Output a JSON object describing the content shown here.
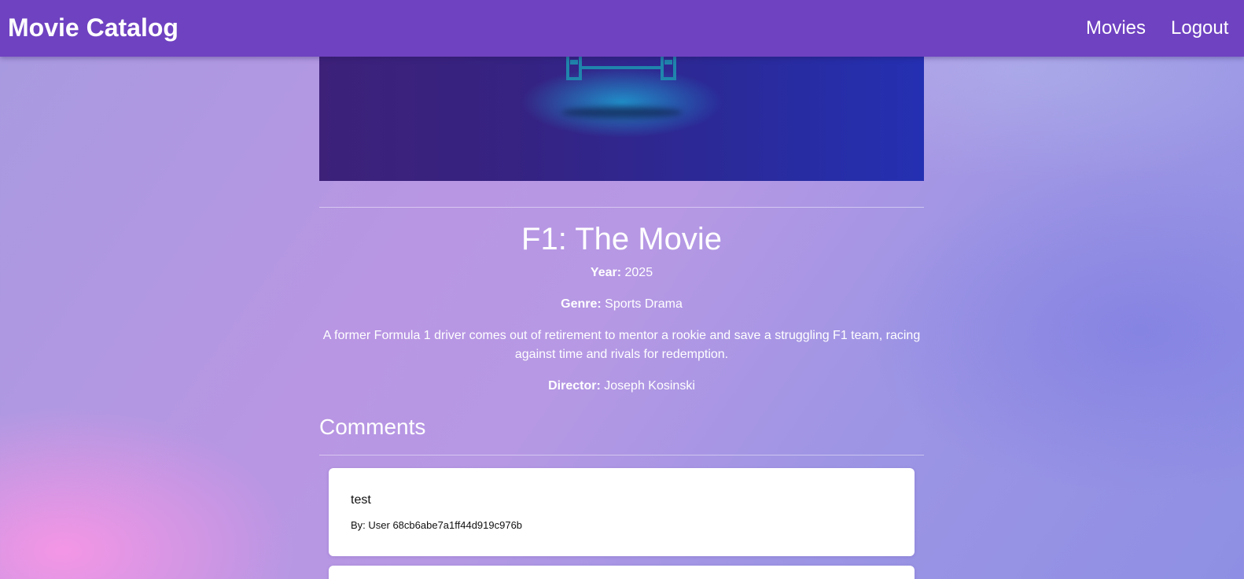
{
  "navbar": {
    "brand": "Movie Catalog",
    "links": [
      "Movies",
      "Logout"
    ],
    "background": "#6f42c1"
  },
  "poster": {
    "icon": "film-reel-icon",
    "colors": [
      "#3d2179",
      "#2430b2",
      "#1e9fd2"
    ]
  },
  "movie": {
    "title": "F1: The Movie",
    "year_label": "Year:",
    "year": "2025",
    "genre_label": "Genre:",
    "genre": "Sports Drama",
    "description": "A former Formula 1 driver comes out of retirement to mentor a rookie and save a struggling F1 team, racing against time and rivals for redemption.",
    "director_label": "Director:",
    "director": "Joseph Kosinski"
  },
  "comments": {
    "heading": "Comments",
    "items": [
      {
        "text": "test",
        "author": "By: User 68cb6abe7a1ff44d919c976b"
      },
      {
        "text": "",
        "author": ""
      }
    ]
  }
}
